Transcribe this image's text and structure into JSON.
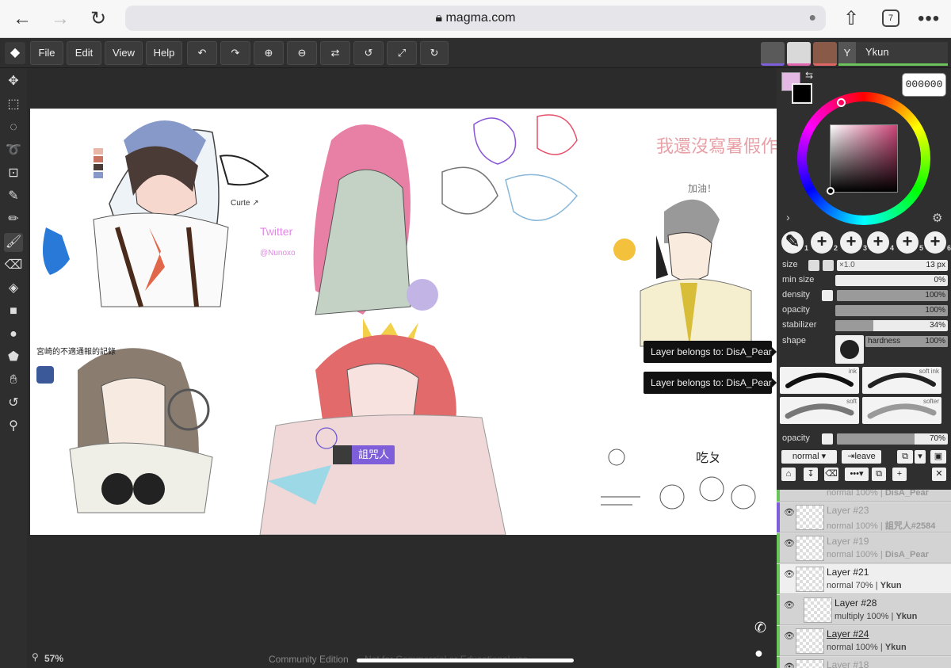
{
  "browser": {
    "url": "magma.com",
    "tab_count": "7"
  },
  "menu": {
    "file": "File",
    "edit": "Edit",
    "view": "View",
    "help": "Help"
  },
  "user": {
    "initial": "Y",
    "name": "Ykun"
  },
  "colors": {
    "primary": "#e3b9e3",
    "secondary": "#000000",
    "hex_value": "000000",
    "accent": "#7e5fd9",
    "user_bar": "#6bc35b"
  },
  "brush_slots": [
    "1",
    "2",
    "3",
    "4",
    "5",
    "6"
  ],
  "brush": {
    "size_label": "size",
    "size_mult": "×1.0",
    "size_value": "13 px",
    "min_size_label": "min size",
    "min_size_value": "0%",
    "min_size_pct": 0,
    "density_label": "density",
    "density_value": "100%",
    "density_pct": 100,
    "opacity_label": "opacity",
    "opacity_value": "100%",
    "opacity_pct": 100,
    "stabilizer_label": "stabilizer",
    "stabilizer_value": "34%",
    "stabilizer_pct": 34,
    "shape_label": "shape",
    "hardness_label": "hardness",
    "hardness_value": "100%"
  },
  "brush_presets": [
    "ink",
    "soft ink",
    "soft",
    "softer"
  ],
  "layer_opacity": {
    "label": "opacity",
    "value": "70%",
    "pct": 70
  },
  "blend": {
    "mode": "normal",
    "leave": "leave"
  },
  "tooltips": [
    "Layer belongs to: DisA_Pear",
    "Layer belongs to: DisA_Pear"
  ],
  "cursor_user": "詛咒人",
  "layers": [
    {
      "name": "",
      "meta_mode": "normal 100%",
      "owner": "DisA_Pear",
      "dim": true
    },
    {
      "name": "Layer #23",
      "meta_mode": "normal 100%",
      "owner": "詛咒人#2584",
      "dim": true
    },
    {
      "name": "Layer #19",
      "meta_mode": "normal 100%",
      "owner": "DisA_Pear",
      "dim": true
    },
    {
      "name": "Layer #21",
      "meta_mode": "normal 70%",
      "owner": "Ykun",
      "dim": false
    },
    {
      "name": "Layer #28",
      "meta_mode": "multiply 100%",
      "owner": "Ykun",
      "dim": false
    },
    {
      "name": "Layer #24",
      "meta_mode": "normal 100%",
      "owner": "Ykun",
      "dim": false
    },
    {
      "name": "Layer #18",
      "meta_mode": "",
      "owner": "",
      "dim": true
    }
  ],
  "footer": {
    "zoom": "57%",
    "edition": "Community Edition",
    "notice": "Not for Commercial or Educational use"
  },
  "art_text": {
    "curte": "Curte ↗",
    "twitter": "Twitter",
    "handle": "@Nunoxo",
    "chinese_right": "我還沒寫暑假作業！",
    "jiayou": "加油！",
    "eat": "吃ㄆ",
    "left_note": "宮崎的不適通報的記錄"
  }
}
